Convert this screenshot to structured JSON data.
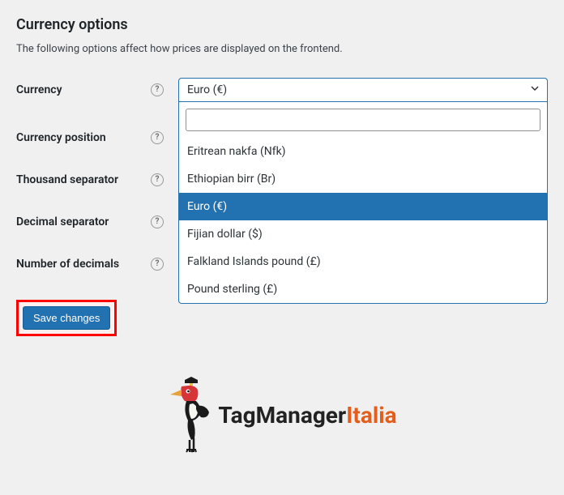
{
  "page": {
    "title": "Currency options",
    "description": "The following options affect how prices are displayed on the frontend."
  },
  "form": {
    "currency": {
      "label": "Currency",
      "selected": "Euro (€)",
      "search_value": "",
      "options": [
        {
          "label": "Eritrean nakfa (Nfk)",
          "highlighted": false
        },
        {
          "label": "Ethiopian birr (Br)",
          "highlighted": false
        },
        {
          "label": "Euro (€)",
          "highlighted": true
        },
        {
          "label": "Fijian dollar ($)",
          "highlighted": false
        },
        {
          "label": "Falkland Islands pound (£)",
          "highlighted": false
        },
        {
          "label": "Pound sterling (£)",
          "highlighted": false
        }
      ]
    },
    "currency_position": {
      "label": "Currency position"
    },
    "thousand_separator": {
      "label": "Thousand separator"
    },
    "decimal_separator": {
      "label": "Decimal separator"
    },
    "number_of_decimals": {
      "label": "Number of decimals"
    },
    "save_button": "Save changes"
  },
  "logo": {
    "brand_main": "TagManager",
    "brand_accent": "Italia"
  }
}
